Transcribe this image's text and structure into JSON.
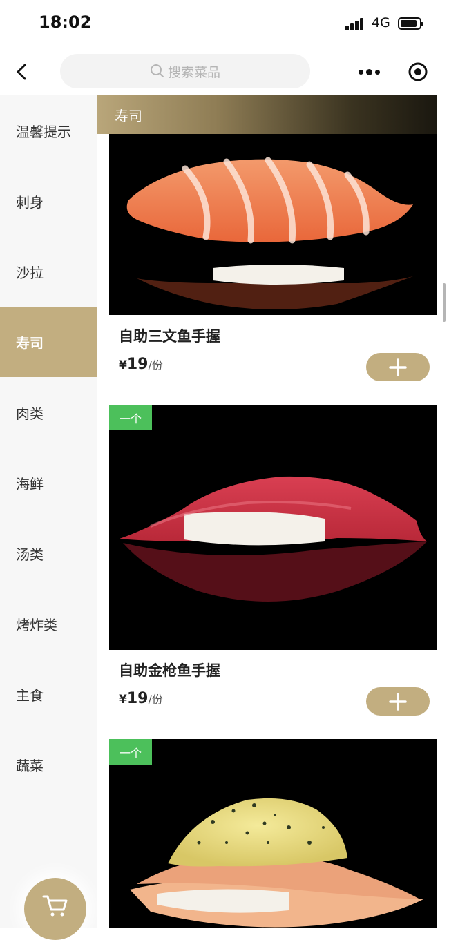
{
  "status_bar": {
    "time": "18:02",
    "network": "4G"
  },
  "nav": {
    "search_placeholder": "搜索菜品"
  },
  "sidebar": {
    "items": [
      {
        "label": "温馨提示",
        "active": false
      },
      {
        "label": "刺身",
        "active": false
      },
      {
        "label": "沙拉",
        "active": false
      },
      {
        "label": "寿司",
        "active": true
      },
      {
        "label": "肉类",
        "active": false
      },
      {
        "label": "海鲜",
        "active": false
      },
      {
        "label": "汤类",
        "active": false
      },
      {
        "label": "烤炸类",
        "active": false
      },
      {
        "label": "主食",
        "active": false
      },
      {
        "label": "蔬菜",
        "active": false
      }
    ]
  },
  "section": {
    "title": "寿司"
  },
  "dishes": [
    {
      "name": "自助三文鱼手握",
      "currency": "¥",
      "price": "19",
      "unit": "/份",
      "tag": ""
    },
    {
      "name": "自助金枪鱼手握",
      "currency": "¥",
      "price": "19",
      "unit": "/份",
      "tag": "一个"
    },
    {
      "name": "",
      "currency": "",
      "price": "",
      "unit": "",
      "tag": "一个"
    }
  ],
  "colors": {
    "accent": "#c2ae80",
    "tag_green": "#4cc05b",
    "sidebar_bg": "#f7f7f7"
  },
  "icons": {
    "back": "chevron-left-icon",
    "search": "search-icon",
    "more": "more-dots-icon",
    "target": "target-icon",
    "add": "plus-icon",
    "cart": "cart-icon"
  }
}
